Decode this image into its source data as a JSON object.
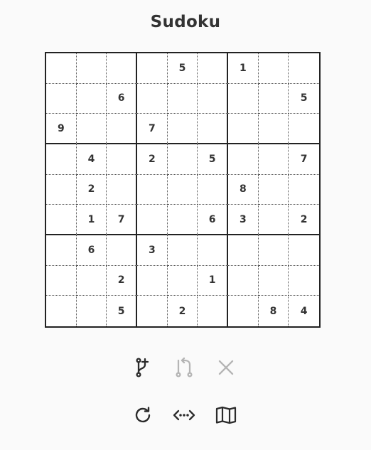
{
  "title": "Sudoku",
  "grid": [
    [
      "",
      "",
      "",
      "",
      "5",
      "",
      "1",
      "",
      ""
    ],
    [
      "",
      "",
      "6",
      "",
      "",
      "",
      "",
      "",
      "5"
    ],
    [
      "9",
      "",
      "",
      "7",
      "",
      "",
      "",
      "",
      ""
    ],
    [
      "",
      "4",
      "",
      "2",
      "",
      "5",
      "",
      "",
      "7"
    ],
    [
      "",
      "2",
      "",
      "",
      "",
      "",
      "8",
      "",
      ""
    ],
    [
      "",
      "1",
      "7",
      "",
      "",
      "6",
      "3",
      "",
      "2"
    ],
    [
      "",
      "6",
      "",
      "3",
      "",
      "",
      "",
      "",
      ""
    ],
    [
      "",
      "",
      "2",
      "",
      "",
      "1",
      "",
      "",
      ""
    ],
    [
      "",
      "",
      "5",
      "",
      "2",
      "",
      "",
      "8",
      "4"
    ]
  ],
  "toolbar": {
    "row1": [
      {
        "icon": "branch-add-icon",
        "enabled": true
      },
      {
        "icon": "revert-branch-icon",
        "enabled": false
      },
      {
        "icon": "close-icon",
        "enabled": false
      }
    ],
    "row2": [
      {
        "icon": "refresh-icon",
        "enabled": true
      },
      {
        "icon": "code-arrows-icon",
        "enabled": true
      },
      {
        "icon": "map-icon",
        "enabled": true
      }
    ]
  },
  "colors": {
    "icon_enabled": "#2b2b2b",
    "icon_disabled": "#b5b5b5",
    "text": "#333333",
    "grid_thick": "#222222",
    "grid_thin": "#555555"
  }
}
